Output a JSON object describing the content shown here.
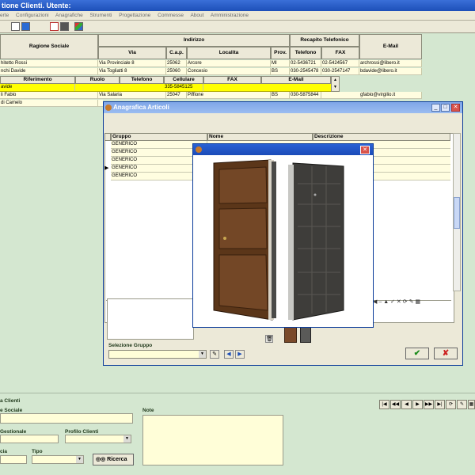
{
  "window": {
    "title": "tione Clienti. Utente:"
  },
  "menu": [
    "erte",
    "Configurazioni",
    "Anagrafiche",
    "Strumenti",
    "Progettazione",
    "Commesse",
    "About",
    "Amministrazione"
  ],
  "grid": {
    "headers": {
      "ragione_sociale": "Ragione Sociale",
      "indirizzo": "Indirizzo",
      "via": "Via",
      "cap": "C.a.p.",
      "localita": "Localita",
      "prov": "Prov.",
      "recapito": "Recapito Telefonico",
      "telefono": "Telefono",
      "fax": "FAX",
      "email": "E-Mail"
    },
    "rows": [
      {
        "ragione": "hitetto Rossi",
        "via": "Via Provinciale 8",
        "cap": "25062",
        "localita": "Arcore",
        "prov": "MI",
        "tel": "02-5436721",
        "fax": "02-5424567",
        "email": "archrossi@libero.it"
      },
      {
        "ragione": "nchi Davide",
        "via": "Via Togliatti 8",
        "cap": "25060",
        "localita": "Concesio",
        "prov": "BS",
        "tel": "030-2545478",
        "fax": "030-2547147",
        "email": "bdavide@libero.it"
      },
      {
        "ragione": "li Fabio",
        "via": "Via Salaria",
        "cap": "25047",
        "localita": "Piffione",
        "prov": "BS",
        "tel": "030-5875844",
        "fax": "",
        "email": "gfabio@virgilio.it"
      },
      {
        "ragione": "di Camelo",
        "via": "",
        "cap": "",
        "localita": "",
        "prov": "",
        "tel": "",
        "fax": "",
        "email": ""
      }
    ],
    "subgrid": {
      "headers": [
        "Riferimento",
        "Ruolo",
        "Telefono",
        "Cellulare",
        "FAX",
        "E-Mail"
      ],
      "row": {
        "riferimento": "avide",
        "cellulare": "335-5845125"
      }
    }
  },
  "child_window": {
    "title": "Anagrafica Articoli",
    "columns": [
      "Gruppo",
      "Nome",
      "Descrizione"
    ],
    "rows": [
      "GENERICO",
      "GENERICO",
      "GENERICO",
      "GENERICO",
      "GENERICO"
    ],
    "selezione_label": "Selezione Gruppo"
  },
  "bottom": {
    "title": "a Clienti",
    "ragione_label": "e Sociale",
    "gestionale_label": "Gestionale",
    "profilo_label": "Profilo Clienti",
    "cia_label": "cia",
    "tipo_label": "Tipo",
    "ricerca_label": "Ricerca",
    "note_label": "Note"
  },
  "colors": {
    "accent": "#1d4fb8",
    "grid_row": "#fffde0",
    "selected_row": "#ffff00",
    "background": "#d4e7d0"
  }
}
